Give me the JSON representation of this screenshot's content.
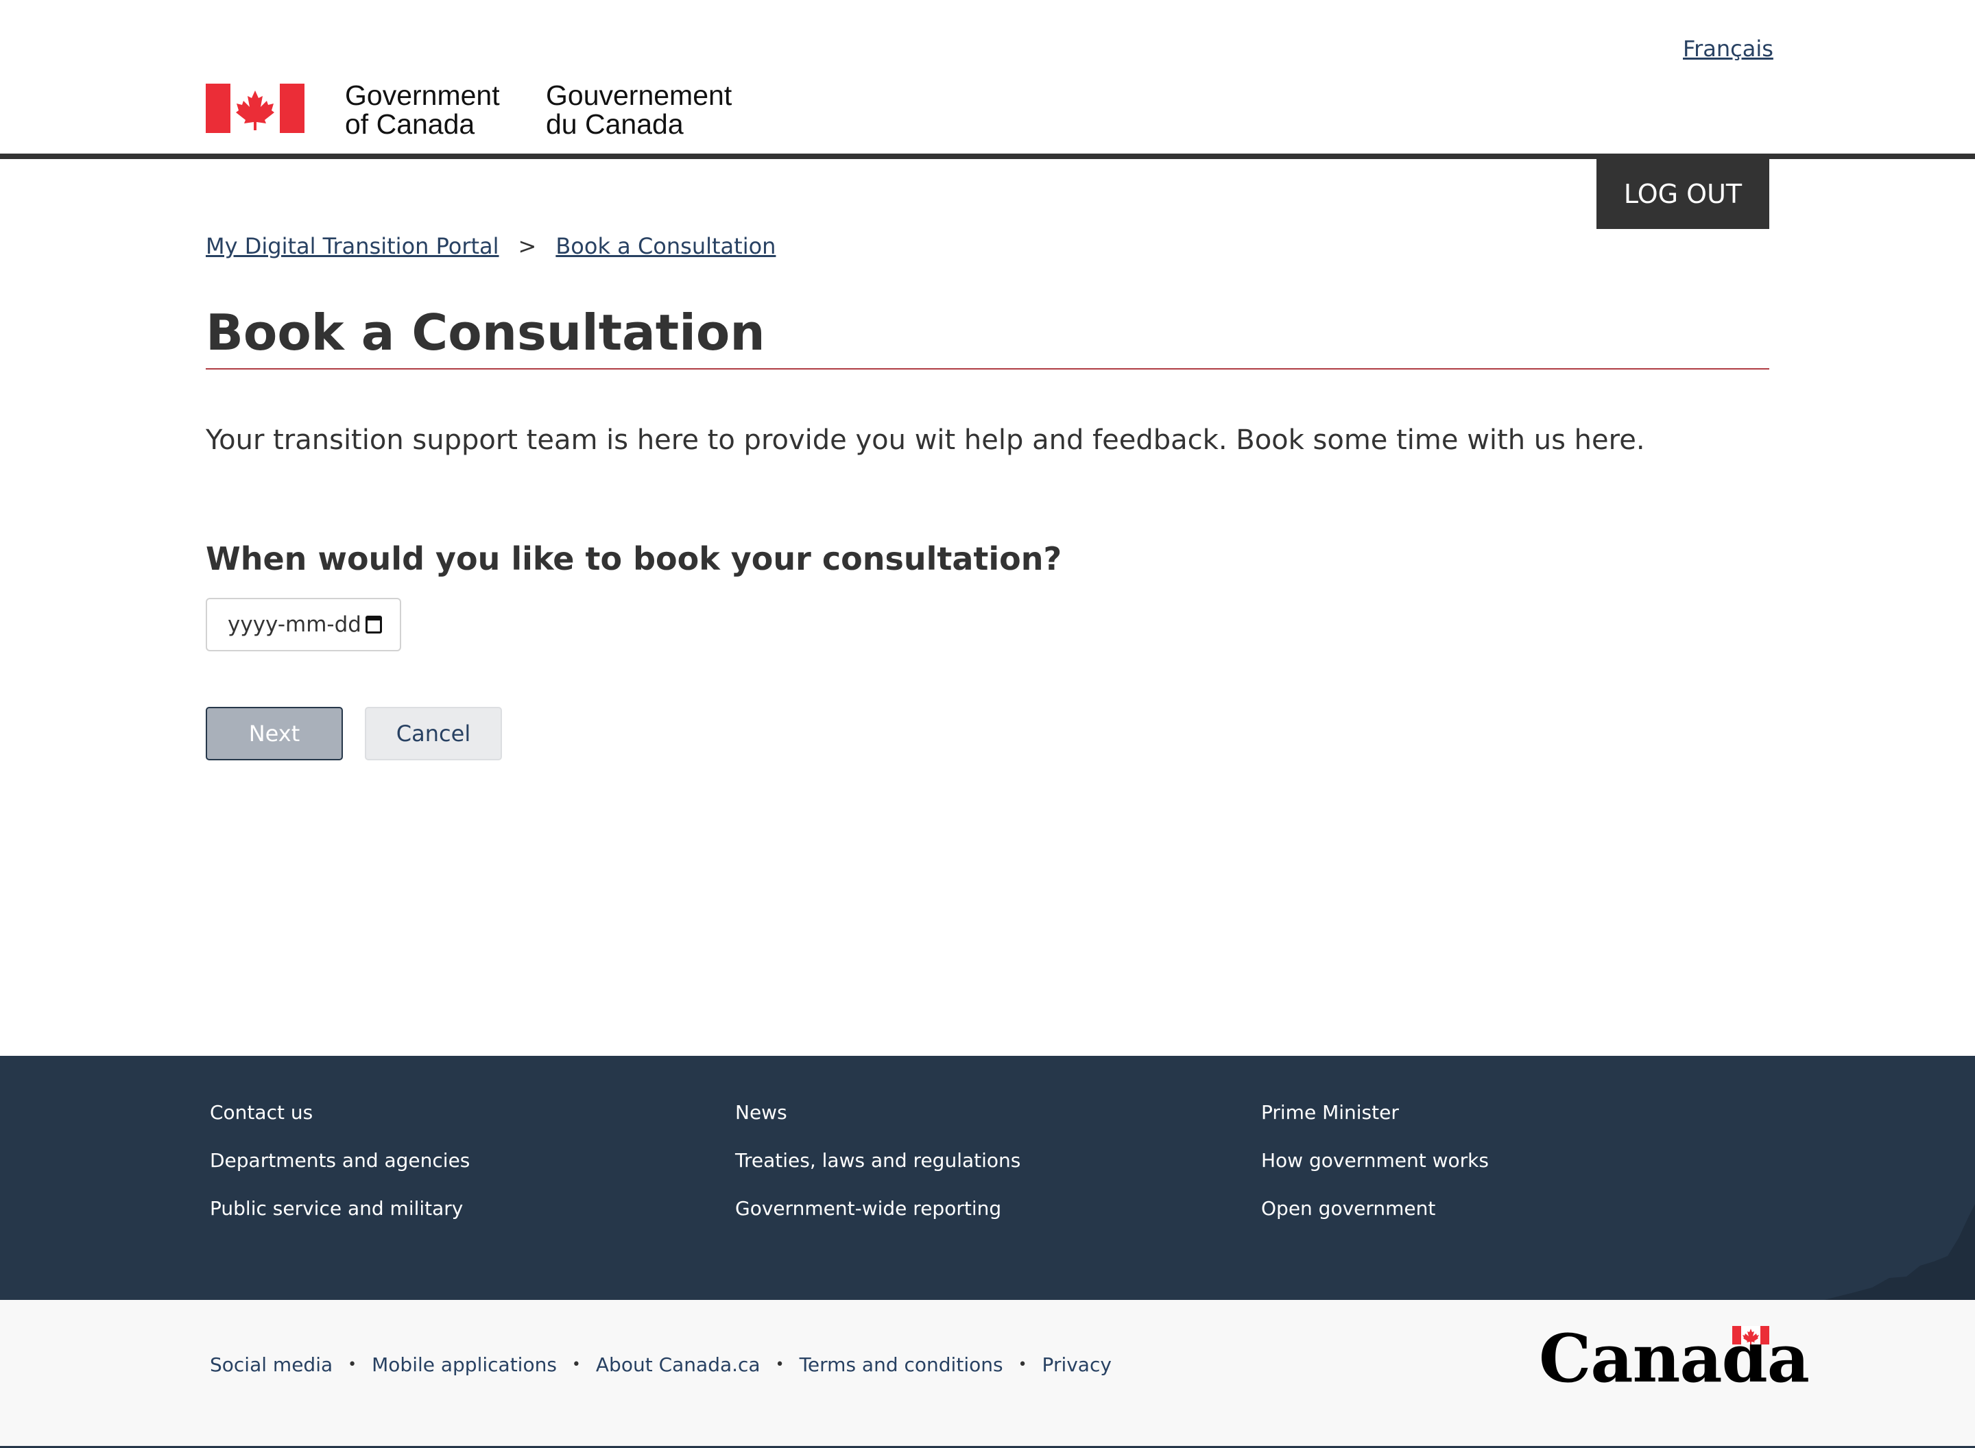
{
  "header": {
    "language_link": "Français",
    "wordmark_en_line1": "Government",
    "wordmark_en_line2": "of Canada",
    "wordmark_fr_line1": "Gouvernement",
    "wordmark_fr_line2": "du Canada",
    "logout_label": "LOG OUT"
  },
  "breadcrumb": {
    "items": [
      "My Digital Transition Portal",
      "Book a Consultation"
    ],
    "separator": ">"
  },
  "main": {
    "title": "Book a Consultation",
    "intro": "Your transition support team is here to provide you wit help and feedback.  Book some time with us here.",
    "question": "When would you like to book your consultation?",
    "date_placeholder": "yyyy-mm-dd",
    "next_label": "Next",
    "cancel_label": "Cancel"
  },
  "footer": {
    "columns": [
      [
        "Contact us",
        "Departments and agencies",
        "Public service and military"
      ],
      [
        "News",
        "Treaties, laws and regulations",
        "Government-wide reporting"
      ],
      [
        "Prime Minister",
        "How government works",
        "Open government"
      ]
    ],
    "sub_links": [
      "Social media",
      "Mobile applications",
      "About Canada.ca",
      "Terms and conditions",
      "Privacy"
    ],
    "canada_wordmark": "Canada"
  },
  "colors": {
    "flag_red": "#eb2d37",
    "header_rule": "#333333",
    "link": "#284162",
    "title_rule": "#af3c43",
    "footer_bg": "#26374a",
    "subfooter_bg": "#f8f8f8"
  }
}
